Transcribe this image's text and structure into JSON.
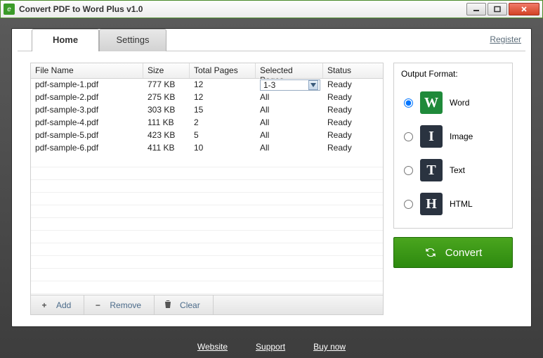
{
  "window": {
    "title": "Convert PDF to Word Plus v1.0"
  },
  "tabs": {
    "home": "Home",
    "settings": "Settings"
  },
  "register": "Register",
  "columns": {
    "name": "File Name",
    "size": "Size",
    "pages": "Total Pages",
    "selected": "Selected Pages",
    "status": "Status"
  },
  "rows": [
    {
      "name": "pdf-sample-1.pdf",
      "size": "777 KB",
      "pages": "12",
      "selected": "1-3",
      "status": "Ready",
      "dropdown": true
    },
    {
      "name": "pdf-sample-2.pdf",
      "size": "275 KB",
      "pages": "12",
      "selected": "All",
      "status": "Ready"
    },
    {
      "name": "pdf-sample-3.pdf",
      "size": "303 KB",
      "pages": "15",
      "selected": "All",
      "status": "Ready"
    },
    {
      "name": "pdf-sample-4.pdf",
      "size": "111 KB",
      "pages": "2",
      "selected": "All",
      "status": "Ready"
    },
    {
      "name": "pdf-sample-5.pdf",
      "size": "423 KB",
      "pages": "5",
      "selected": "All",
      "status": "Ready"
    },
    {
      "name": "pdf-sample-6.pdf",
      "size": "411 KB",
      "pages": "10",
      "selected": "All",
      "status": "Ready"
    }
  ],
  "toolbar": {
    "add": "Add",
    "remove": "Remove",
    "clear": "Clear"
  },
  "output": {
    "title": "Output Format:",
    "options": [
      {
        "key": "word",
        "label": "Word",
        "glyph": "W",
        "checked": true
      },
      {
        "key": "image",
        "label": "Image",
        "glyph": "I",
        "checked": false
      },
      {
        "key": "text",
        "label": "Text",
        "glyph": "T",
        "checked": false
      },
      {
        "key": "html",
        "label": "HTML",
        "glyph": "H",
        "checked": false
      }
    ]
  },
  "convert": "Convert",
  "footer": {
    "website": "Website",
    "support": "Support",
    "buy": "Buy now"
  }
}
